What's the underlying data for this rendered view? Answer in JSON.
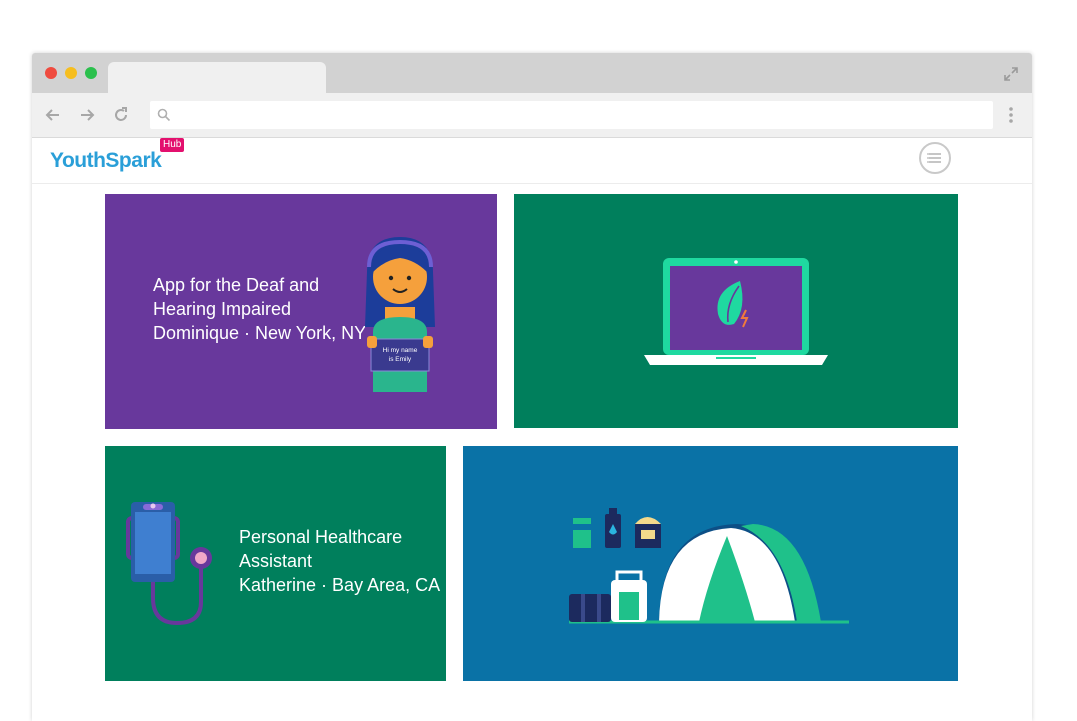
{
  "browser": {
    "address_value": "",
    "traffic_lights": [
      "#ef4b3f",
      "#f6be1f",
      "#2bc04d"
    ]
  },
  "site": {
    "logo_text": "YouthSpark",
    "logo_badge": "Hub",
    "colors": {
      "logo_blue": "#2a9fd8",
      "badge_pink": "#e3106e"
    }
  },
  "cards": [
    {
      "title": "App for the Deaf and Hearing Impaired",
      "byline": "Dominique · New York, NY",
      "illustration_text": "Hi my name is Emily",
      "color": "#68389c"
    },
    {
      "title": "",
      "byline": "",
      "color": "#007f5c"
    },
    {
      "title": "Personal Healthcare Assistant",
      "byline": "Katherine · Bay Area, CA",
      "color": "#007f5c"
    },
    {
      "title": "",
      "byline": "",
      "color": "#0a72a6"
    }
  ]
}
